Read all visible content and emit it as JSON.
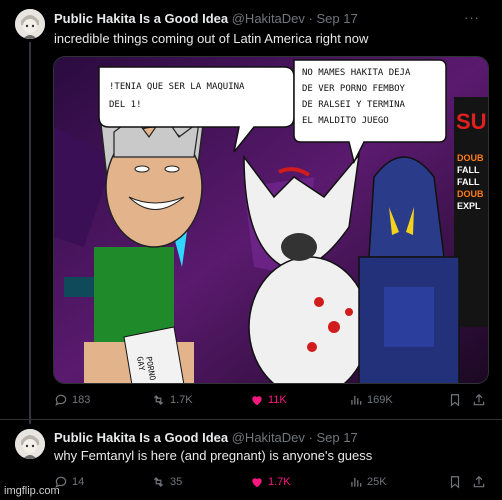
{
  "tweet1": {
    "display_name": "Public Hakita Is a Good Idea",
    "handle": "@HakitaDev",
    "separator": "·",
    "date": "Sep 17",
    "more": "···",
    "text": "incredible things coming out of Latin America right now",
    "media": {
      "bubble_left_line1": "!TENIA QUE SER LA MAQUINA",
      "bubble_left_line2": "DEL 1!",
      "bubble_right_line1": "NO MAMES HAKITA DEJA",
      "bubble_right_line2": "DE VER PORNO FEMBOY",
      "bubble_right_line3": "DE RALSEI Y TERMINA",
      "bubble_right_line4": "EL MALDITO JUEGO",
      "sign_line1": "PORNO",
      "sign_line2": "GAY",
      "game_title": "SUP",
      "game_list": [
        "DOUB",
        "FALL",
        "FALL",
        "DOUB",
        "EXPL"
      ]
    },
    "replies": "183",
    "reposts": "1.7K",
    "likes": "11K",
    "views": "169K"
  },
  "tweet2": {
    "display_name": "Public Hakita Is a Good Idea",
    "handle": "@HakitaDev",
    "separator": "·",
    "date": "Sep 17",
    "text": "why Femtanyl is here (and pregnant) is anyone's guess",
    "replies": "14",
    "reposts": "35",
    "likes": "1.7K",
    "views": "25K"
  },
  "watermark": "imgflip.com",
  "colors": {
    "background": "#000000",
    "muted": "#71767b",
    "like_pink": "#f91880",
    "text": "#e7e9ea"
  }
}
